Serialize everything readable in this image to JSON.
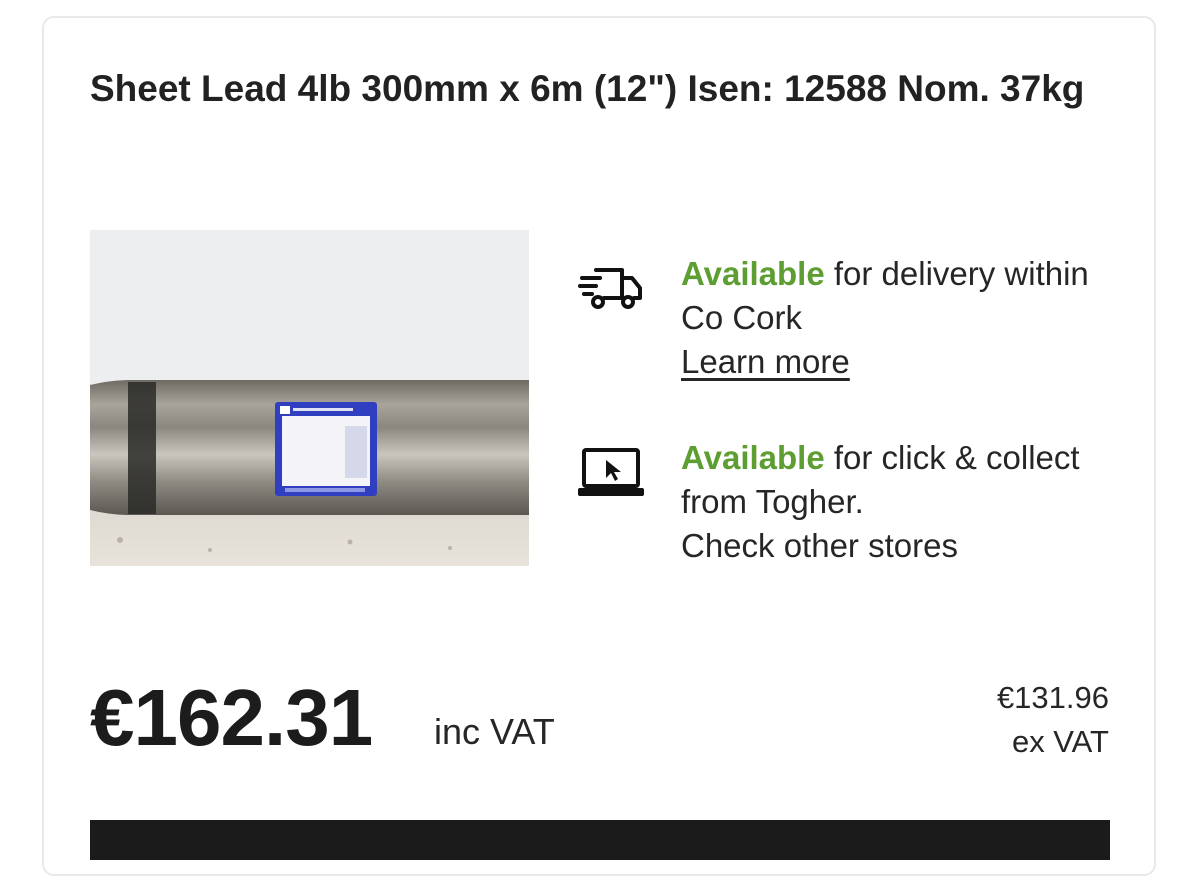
{
  "product": {
    "title": "Sheet Lead 4lb 300mm x 6m (12\") Isen: 12588 Nom. 37kg"
  },
  "availability": {
    "delivery": {
      "status": "Available",
      "text": " for delivery within Co Cork",
      "link": "Learn more"
    },
    "collect": {
      "status": "Available",
      "text": " for click & collect",
      "store_line": "from Togher.",
      "link": "Check other stores"
    }
  },
  "pricing": {
    "inc_vat_price": "€162.31",
    "inc_vat_label": "inc VAT",
    "ex_vat_price": "€131.96",
    "ex_vat_label": "ex VAT"
  },
  "colors": {
    "available_green": "#5c9e31",
    "text_dark": "#1c1c1c",
    "button_black": "#1b1b1b"
  },
  "icons": {
    "delivery": "delivery-truck-icon",
    "collect": "laptop-cursor-icon"
  }
}
